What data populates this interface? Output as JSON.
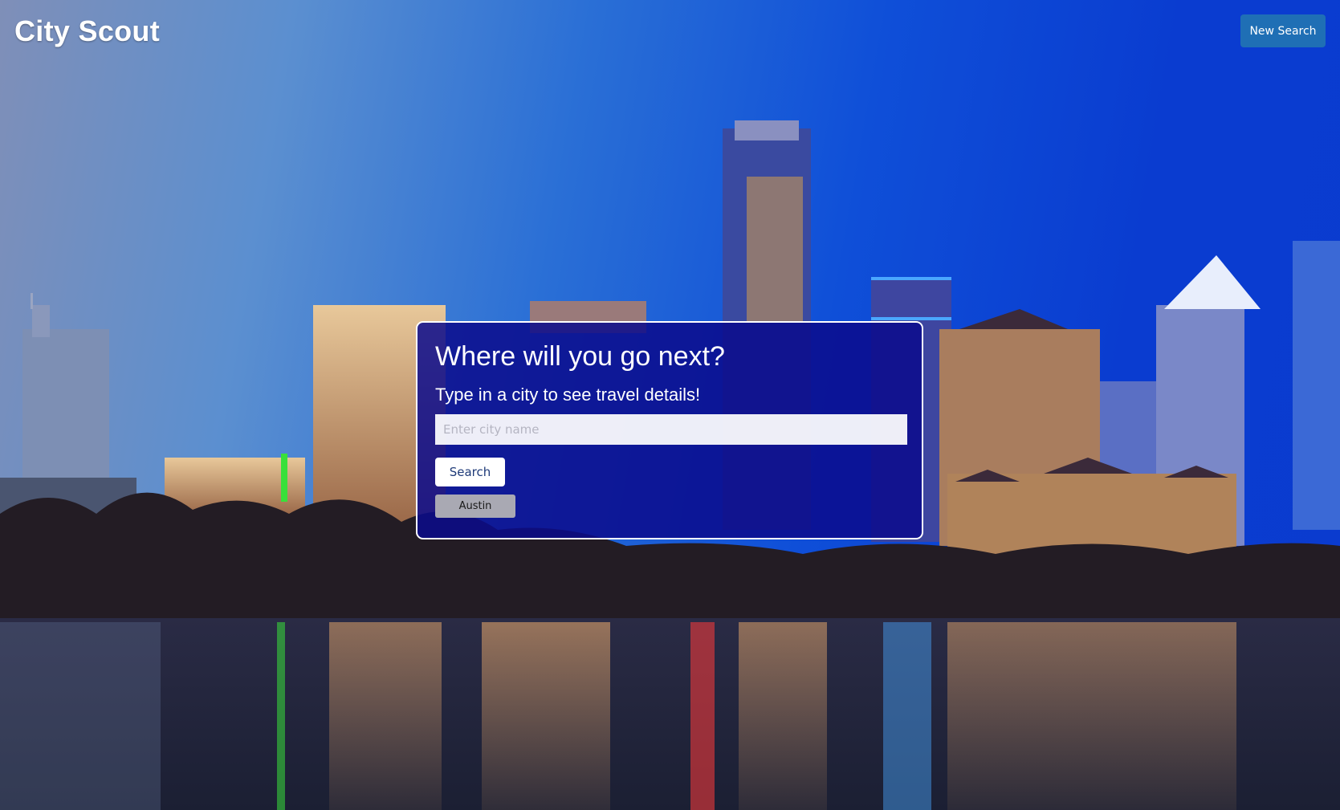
{
  "header": {
    "brand": "City Scout",
    "new_search_label": "New Search"
  },
  "search_card": {
    "title": "Where will you go next?",
    "subtitle": "Type in a city to see travel details!",
    "input": {
      "placeholder": "Enter city name",
      "value": ""
    },
    "search_label": "Search",
    "history": [
      "Austin"
    ]
  },
  "colors": {
    "new_search_button": "#1f6fb5",
    "card_background": "#0a0a8c",
    "card_border": "#ffffff",
    "history_button": "#a9a9b3"
  },
  "background": {
    "image_subject": "city skyline at dusk reflected in river"
  }
}
